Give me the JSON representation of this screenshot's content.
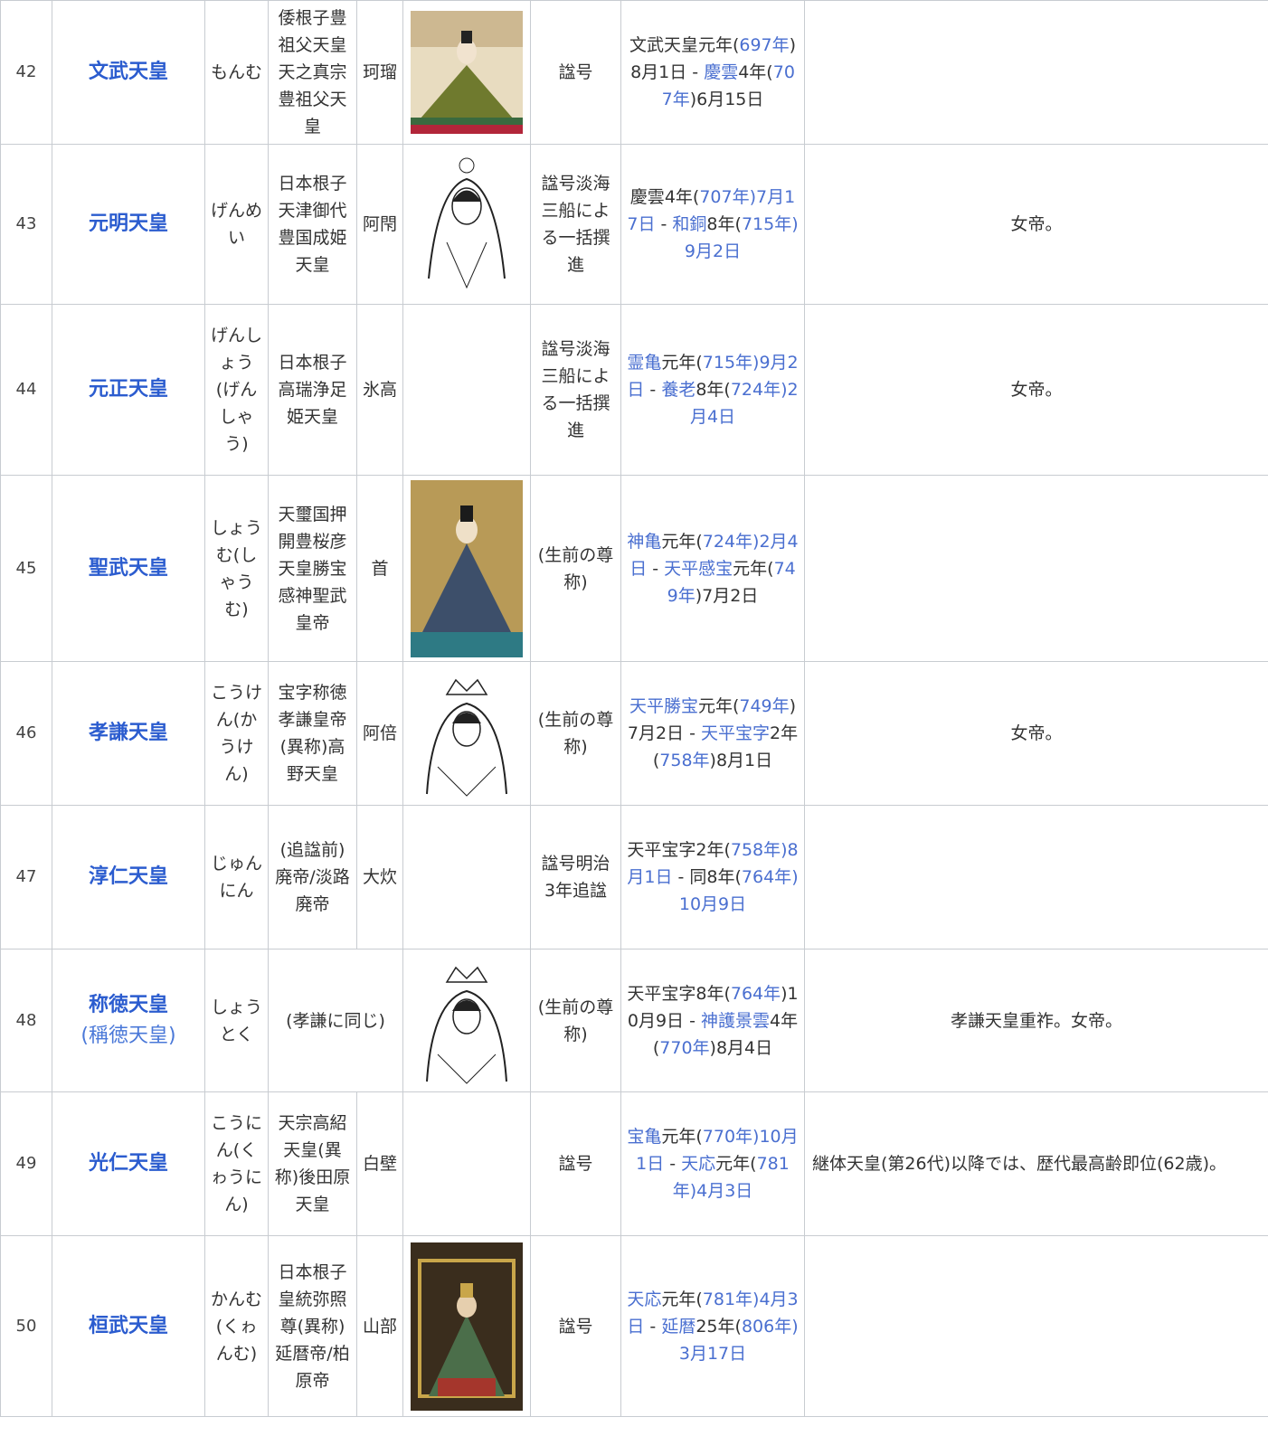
{
  "rows": [
    {
      "num": "42",
      "name": "文武天皇",
      "reading": "もんむ",
      "posthumous": "倭根子豊祖父天皇天之真宗豊祖父天皇",
      "imina": "珂瑠",
      "portrait": "seated-emperor-painting",
      "title_type": "諡号",
      "reign_parts": [
        {
          "t": "文武天皇元年(",
          "l": false
        },
        {
          "t": "697年",
          "l": true
        },
        {
          "t": ")8月1日",
          "l": false
        },
        {
          "t": " - ",
          "l": false
        },
        {
          "t": "慶雲",
          "l": true
        },
        {
          "t": "4年(",
          "l": false
        },
        {
          "t": "707年",
          "l": true
        },
        {
          "t": ")6月15日",
          "l": false
        }
      ],
      "notes": ""
    },
    {
      "num": "43",
      "name": "元明天皇",
      "reading": "げんめい",
      "posthumous": "日本根子天津御代豊国成姫天皇",
      "imina": "阿閇",
      "portrait": "empress-line-drawing",
      "title_type": "諡号淡海三船による一括撰進",
      "reign_parts": [
        {
          "t": "慶雲",
          "l": false
        },
        {
          "t": "4年(",
          "l": false
        },
        {
          "t": "707年",
          "l": true
        },
        {
          "t": ")7月17日",
          "l": true
        },
        {
          "t": " - ",
          "l": false
        },
        {
          "t": "和銅",
          "l": true
        },
        {
          "t": "8年(",
          "l": false
        },
        {
          "t": "715年",
          "l": true
        },
        {
          "t": ")9月2日",
          "l": true
        }
      ],
      "notes": "女帝。"
    },
    {
      "num": "44",
      "name": "元正天皇",
      "reading": "げんしょう(げんしゃう)",
      "posthumous": "日本根子高瑞浄足姫天皇",
      "imina": "氷高",
      "portrait": "",
      "title_type": "諡号淡海三船による一括撰進",
      "reign_parts": [
        {
          "t": "霊亀",
          "l": true
        },
        {
          "t": "元年(",
          "l": false
        },
        {
          "t": "715年",
          "l": true
        },
        {
          "t": ")9月2日",
          "l": true
        },
        {
          "t": " - ",
          "l": false
        },
        {
          "t": "養老",
          "l": true
        },
        {
          "t": "8年(",
          "l": false
        },
        {
          "t": "724年",
          "l": true
        },
        {
          "t": ")2月4日",
          "l": true
        }
      ],
      "notes": "女帝。"
    },
    {
      "num": "45",
      "name": "聖武天皇",
      "reading": "しょうむ(しゃうむ)",
      "posthumous": "天璽国押開豊桜彦天皇勝宝感神聖武皇帝",
      "imina": "首",
      "portrait": "seated-emperor-blue-robe",
      "title_type": "(生前の尊称)",
      "reign_parts": [
        {
          "t": "神亀",
          "l": true
        },
        {
          "t": "元年(",
          "l": false
        },
        {
          "t": "724年",
          "l": true
        },
        {
          "t": ")2月4日",
          "l": true
        },
        {
          "t": " - ",
          "l": false
        },
        {
          "t": "天平感宝",
          "l": true
        },
        {
          "t": "元年(",
          "l": false
        },
        {
          "t": "749年",
          "l": true
        },
        {
          "t": ")7月2日",
          "l": false
        }
      ],
      "notes": ""
    },
    {
      "num": "46",
      "name": "孝謙天皇",
      "reading": "こうけん(かうけん)",
      "posthumous": "宝字称徳孝謙皇帝(異称)高野天皇",
      "imina": "阿倍",
      "portrait": "empress-crown-drawing",
      "title_type": "(生前の尊称)",
      "reign_parts": [
        {
          "t": "天平勝宝",
          "l": true
        },
        {
          "t": "元年(",
          "l": false
        },
        {
          "t": "749年",
          "l": true
        },
        {
          "t": ")7月2日",
          "l": false
        },
        {
          "t": " - ",
          "l": false
        },
        {
          "t": "天平宝字",
          "l": true
        },
        {
          "t": "2年(",
          "l": false
        },
        {
          "t": "758年",
          "l": true
        },
        {
          "t": ")8月1日",
          "l": false
        }
      ],
      "notes": "女帝。"
    },
    {
      "num": "47",
      "name": "淳仁天皇",
      "reading": "じゅんにん",
      "posthumous": "(追諡前)廃帝/淡路廃帝",
      "imina": "大炊",
      "portrait": "",
      "title_type": "諡号明治3年追諡",
      "reign_parts": [
        {
          "t": "天平宝字",
          "l": false
        },
        {
          "t": "2年(",
          "l": false
        },
        {
          "t": "758年",
          "l": true
        },
        {
          "t": ")8月1日",
          "l": true
        },
        {
          "t": " - 同8年(",
          "l": false
        },
        {
          "t": "764年",
          "l": true
        },
        {
          "t": ")10月9日",
          "l": true
        }
      ],
      "notes": ""
    },
    {
      "num": "48",
      "name": "称徳天皇",
      "name_alt": "(稱徳天皇)",
      "reading": "しょうとく",
      "posthumous": "(孝謙に同じ)",
      "imina": "",
      "portrait": "empress-crown-drawing",
      "title_type": "(生前の尊称)",
      "reign_parts": [
        {
          "t": "天平宝字",
          "l": false
        },
        {
          "t": "8年(",
          "l": false
        },
        {
          "t": "764年",
          "l": true
        },
        {
          "t": ")10月9日",
          "l": false
        },
        {
          "t": " - ",
          "l": false
        },
        {
          "t": "神護景雲",
          "l": true
        },
        {
          "t": "4年(",
          "l": false
        },
        {
          "t": "770年",
          "l": true
        },
        {
          "t": ")8月4日",
          "l": false
        }
      ],
      "notes": "孝謙天皇重祚。女帝。"
    },
    {
      "num": "49",
      "name": "光仁天皇",
      "reading": "こうにん(くゎうにん)",
      "posthumous": "天宗高紹天皇(異称)後田原天皇",
      "imina": "白壁",
      "portrait": "",
      "title_type": "諡号",
      "reign_parts": [
        {
          "t": "宝亀",
          "l": true
        },
        {
          "t": "元年(",
          "l": false
        },
        {
          "t": "770年",
          "l": true
        },
        {
          "t": ")10月1日",
          "l": true
        },
        {
          "t": " - ",
          "l": false
        },
        {
          "t": "天応",
          "l": true
        },
        {
          "t": "元年(",
          "l": false
        },
        {
          "t": "781年",
          "l": true
        },
        {
          "t": ")4月3日",
          "l": true
        }
      ],
      "notes": "継体天皇(第26代)以降では、歴代最高齢即位(62歳)。"
    },
    {
      "num": "50",
      "name": "桓武天皇",
      "reading": "かんむ(くゎんむ)",
      "posthumous": "日本根子皇統弥照尊(異称)延暦帝/柏原帝",
      "imina": "山部",
      "portrait": "seated-emperor-throne",
      "title_type": "諡号",
      "reign_parts": [
        {
          "t": "天応",
          "l": true
        },
        {
          "t": "元年(",
          "l": false
        },
        {
          "t": "781年",
          "l": true
        },
        {
          "t": ")4月3日",
          "l": true
        },
        {
          "t": " - ",
          "l": false
        },
        {
          "t": "延暦",
          "l": true
        },
        {
          "t": "25年(",
          "l": false
        },
        {
          "t": "806年",
          "l": true
        },
        {
          "t": ")3月17日",
          "l": true
        }
      ],
      "notes": ""
    }
  ]
}
